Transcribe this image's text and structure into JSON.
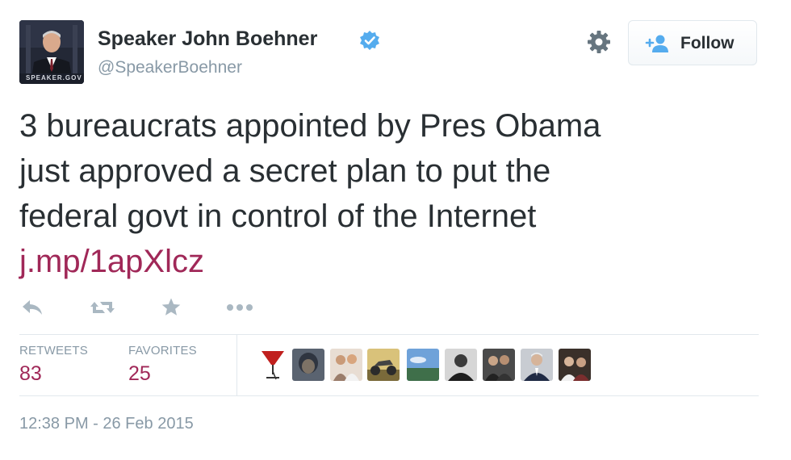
{
  "author": {
    "display_name": "Speaker John Boehner",
    "handle": "@SpeakerBoehner",
    "avatar_caption": "SPEAKER.GOV",
    "verified": true
  },
  "follow_button": {
    "label": "Follow",
    "icon": "add-user-icon"
  },
  "settings_icon": "gear-icon",
  "tweet": {
    "lines": [
      "3 bureaucrats appointed by Pres Obama",
      "just approved a secret plan to put the",
      "federal govt in control of the Internet"
    ],
    "link": "j.mp/1apXlcz"
  },
  "actions": [
    "reply-icon",
    "retweet-icon",
    "favorite-icon",
    "more-icon"
  ],
  "stats": {
    "retweets": {
      "label": "RETWEETS",
      "value": "83"
    },
    "favorites": {
      "label": "FAVORITES",
      "value": "25"
    }
  },
  "timestamp": "12:38 PM - 26 Feb 2015",
  "colors": {
    "text": "#292f33",
    "muted": "#8899a6",
    "link": "#a02858",
    "verified": "#55acee",
    "divider": "#e1e8ed"
  }
}
